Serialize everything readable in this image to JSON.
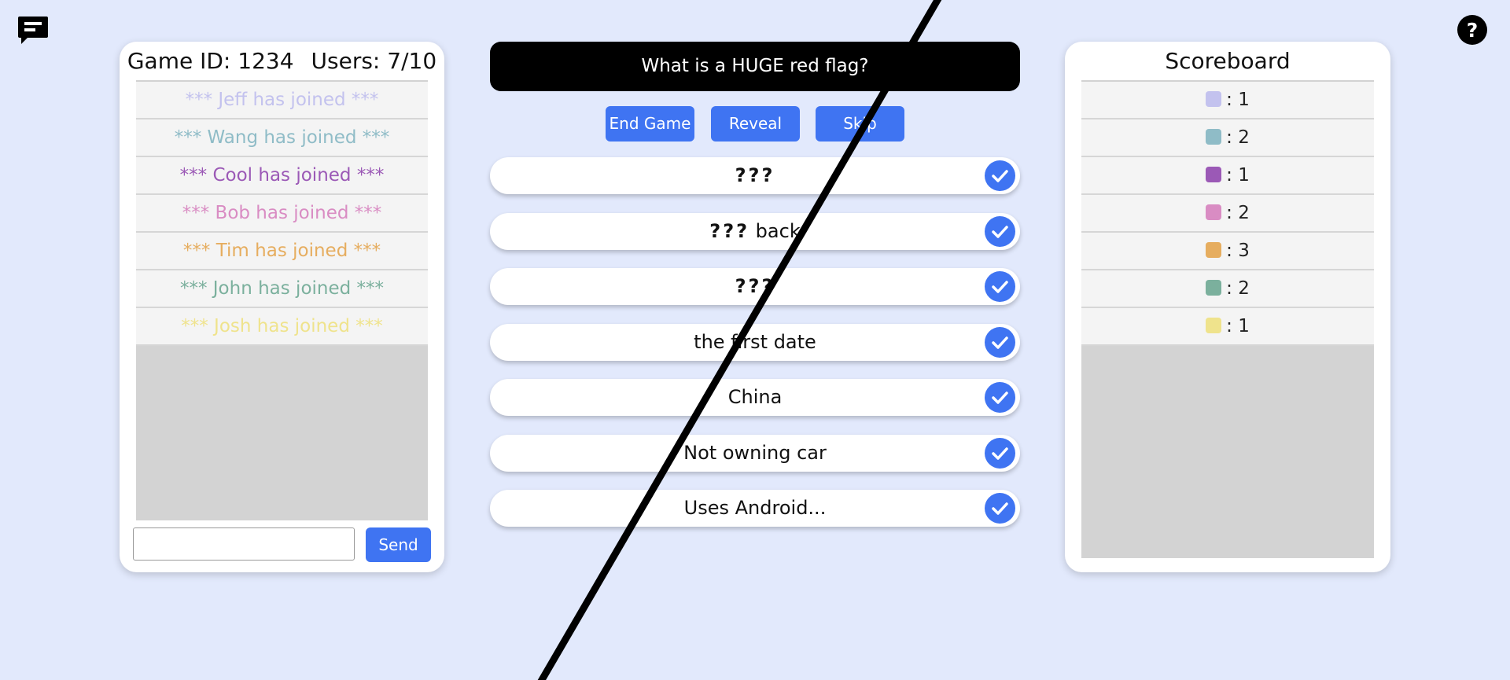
{
  "icons": {
    "chat": "chat-bubble-icon",
    "help": "question-mark-icon"
  },
  "chat_panel": {
    "game_id_label": "Game ID: 1234",
    "users_label": "Users: 7/10",
    "messages": [
      {
        "text": "*** Jeff has joined ***",
        "color": "#c3c2ee"
      },
      {
        "text": "*** Wang has joined ***",
        "color": "#8fbcc7"
      },
      {
        "text": "*** Cool has joined ***",
        "color": "#9b59b6"
      },
      {
        "text": "*** Bob has joined ***",
        "color": "#d98cc3"
      },
      {
        "text": "*** Tim has joined ***",
        "color": "#e6ad5f"
      },
      {
        "text": "*** John has joined ***",
        "color": "#7bb09d"
      },
      {
        "text": "*** Josh has joined ***",
        "color": "#efe38c"
      }
    ],
    "input_value": "",
    "send_label": "Send"
  },
  "question": "What is a HUGE red flag?",
  "controls": {
    "end_label": "End Game",
    "reveal_label": "Reveal",
    "skip_label": "Skip"
  },
  "answers": [
    {
      "text": "???"
    },
    {
      "text": "??? back"
    },
    {
      "text": "???"
    },
    {
      "text": "the first date"
    },
    {
      "text": "China"
    },
    {
      "text": "Not owning car"
    },
    {
      "text": "Uses Android..."
    }
  ],
  "scoreboard": {
    "title": "Scoreboard",
    "scores": [
      {
        "label": ": 1",
        "color": "#c3c2ee"
      },
      {
        "label": ": 2",
        "color": "#8fbcc7"
      },
      {
        "label": ": 1",
        "color": "#9b59b6"
      },
      {
        "label": ": 2",
        "color": "#d98cc3"
      },
      {
        "label": ": 3",
        "color": "#e6ad5f"
      },
      {
        "label": ": 2",
        "color": "#7bb09d"
      },
      {
        "label": ": 1",
        "color": "#efe38c"
      }
    ]
  },
  "colors": {
    "accent": "#3f74f2",
    "background": "#e2e9fc"
  }
}
